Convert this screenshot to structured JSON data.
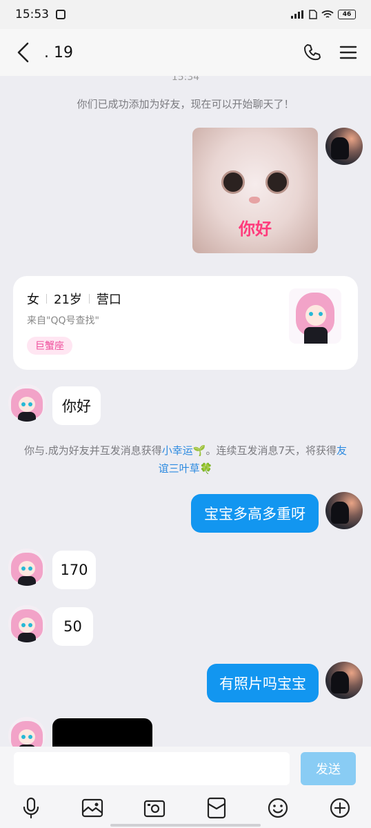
{
  "status_bar": {
    "time": "15:53",
    "battery": "46"
  },
  "header": {
    "title": ". 19"
  },
  "chat": {
    "timestamp": "15:34",
    "friend_added_notice": "你们已成功添加为好友，现在可以开始聊天了！",
    "sticker_caption": "你好",
    "profile_card": {
      "gender": "女",
      "age": "21岁",
      "city": "营口",
      "source": "来自\"QQ号查找\"",
      "zodiac": "巨蟹座"
    },
    "messages": [
      {
        "side": "left",
        "text": "你好"
      },
      {
        "side": "right",
        "text": "宝宝多高多重呀"
      },
      {
        "side": "left",
        "text": "170"
      },
      {
        "side": "left",
        "text": "50"
      },
      {
        "side": "right",
        "text": "有照片吗宝宝"
      }
    ],
    "luck_notice": {
      "part1": "你与.成为好友并互发消息获得",
      "link1": "小幸运",
      "emoji1": "🌱",
      "part2": "。连续互发消息7天，将获得",
      "link2": "友谊三叶草",
      "emoji2": "🍀"
    }
  },
  "composer": {
    "send_label": "发送"
  },
  "toolbar_icons": [
    "microphone-icon",
    "image-icon",
    "camera-icon",
    "red-packet-icon",
    "emoji-icon",
    "plus-icon"
  ]
}
